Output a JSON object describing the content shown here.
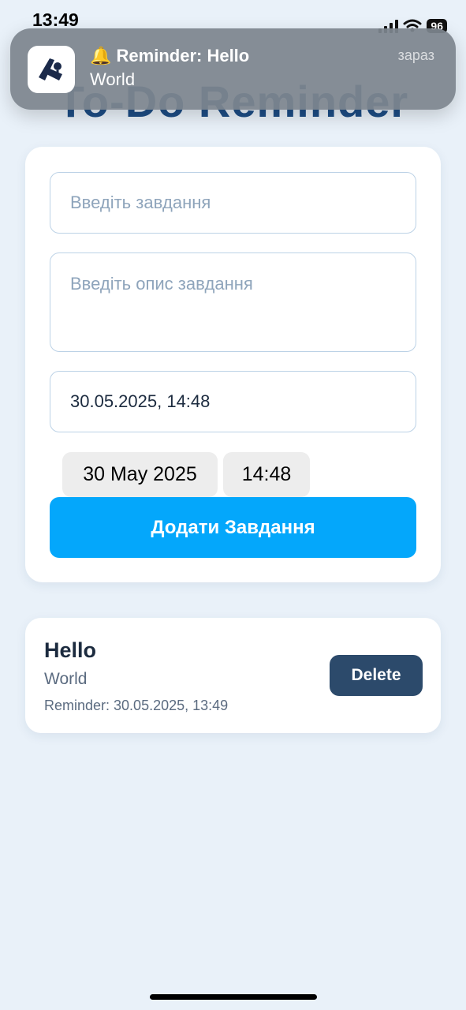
{
  "status_bar": {
    "time": "13:49",
    "battery": "96"
  },
  "app": {
    "title": "To-Do Reminder"
  },
  "notification": {
    "app_icon": "reminder-app-icon",
    "emoji": "🔔",
    "title": "Reminder: Hello",
    "body": "World",
    "time": "зараз"
  },
  "form": {
    "title_placeholder": "Введіть завдання",
    "description_placeholder": "Введіть опис завдання",
    "datetime_value": "30.05.2025, 14:48",
    "picker_date": "30 May 2025",
    "picker_time": "14:48",
    "submit_label": "Додати Завдання"
  },
  "tasks": [
    {
      "title": "Hello",
      "description": "World",
      "reminder": "Reminder: 30.05.2025, 13:49",
      "delete_label": "Delete"
    }
  ],
  "colors": {
    "background": "#e9f1f9",
    "accent": "#04a7fb",
    "delete": "#2c4a6b",
    "title": "#1d4e86"
  }
}
